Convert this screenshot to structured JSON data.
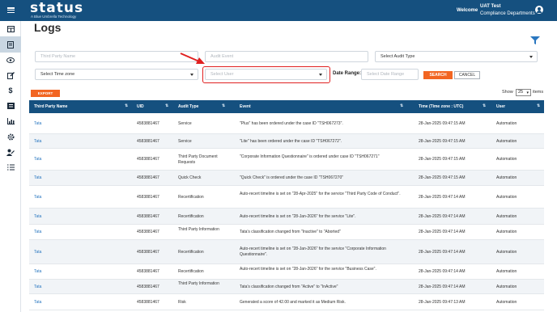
{
  "app": {
    "logo": "status",
    "logo_tagline": "A Blue Umbrella Technology"
  },
  "header": {
    "welcome": "Welcome",
    "user_name": "UAT Test",
    "user_dept": "Compliance Departments"
  },
  "page": {
    "title": "Logs"
  },
  "sidebar": {
    "items": [
      "table-icon",
      "document-icon",
      "eye-icon",
      "edit-icon",
      "dollar-icon",
      "list-icon",
      "chart-icon",
      "gear-icon",
      "user-edit-icon",
      "checklist-icon"
    ]
  },
  "filters": {
    "third_party_placeholder": "Third Party Name",
    "audit_event_placeholder": "Audit Event",
    "audit_type_value": "Select Audit Type",
    "time_zone_value": "Select Time zone",
    "user_placeholder": "Select User",
    "date_range_label": "Date Range:",
    "date_range_placeholder": "Select Date Range",
    "search_label": "SEARCH",
    "cancel_label": "CANCEL"
  },
  "toolbar": {
    "export_label": "EXPORT",
    "show_label": "Show",
    "show_value": "25",
    "items_label": "items"
  },
  "table": {
    "columns": [
      "Third Party Name",
      "UID",
      "Audit Type",
      "Event",
      "Time (Time zone : UTC)",
      "User"
    ],
    "rows": [
      [
        "Tata",
        "4583881467",
        "Service",
        "\"Plus\" has been ordered under the case ID \"TSH067273\".",
        "28-Jan-2025 09:47:15 AM",
        "Automation"
      ],
      [
        "Tata",
        "4583881467",
        "Service",
        "\"Lite\" has been ordered under the case ID \"TSH067272\".",
        "28-Jan-2025 09:47:15 AM",
        "Automation"
      ],
      [
        "Tata",
        "4583881467",
        "Third Party Document Requests",
        "\"Corporate Information Questionnaire\" is ordered under case ID \"TSH067271\"",
        "28-Jan-2025 09:47:15 AM",
        "Automation"
      ],
      [
        "Tata",
        "4583881467",
        "Quick Check",
        "\"Quick Check\" is ordered under the case ID \"TSH067270\"",
        "28-Jan-2025 09:47:15 AM",
        "Automation"
      ],
      [
        "Tata",
        "4583881467",
        "Recertification",
        "Auto-recert timeline is set on \"28-Apr-2025\" for the service \"Third Party Code of Conduct\".",
        "28-Jan-2025 09:47:14 AM",
        "Automation"
      ],
      [
        "Tata",
        "4583881467",
        "Recertification",
        "Auto-recert timeline is set on \"28-Jan-2026\" for the service \"Lite\".",
        "28-Jan-2025 09:47:14 AM",
        "Automation"
      ],
      [
        "Tata",
        "4583881467",
        "Third Party Information",
        "Tata's classification changed from \"Inactive\" to \"Aborted\"",
        "28-Jan-2025 09:47:14 AM",
        "Automation"
      ],
      [
        "Tata",
        "4583881467",
        "Recertification",
        "Auto-recert timeline is set on \"28-Jan-2026\" for the service \"Corporate Information Questionnaire\".",
        "28-Jan-2025 09:47:14 AM",
        "Automation"
      ],
      [
        "Tata",
        "4583881467",
        "Recertification",
        "Auto-recert timeline is set on \"28-Jan-2026\" for the service \"Business Case\".",
        "28-Jan-2025 09:47:14 AM",
        "Automation"
      ],
      [
        "Tata",
        "4583881467",
        "Third Party Information",
        "Tata's classification changed from \"Active\" to \"InActive\"",
        "28-Jan-2025 09:47:14 AM",
        "Automation"
      ],
      [
        "Tata",
        "4583881467",
        "Risk",
        "Generated a score of 42.00 and marked it as Medium Risk.",
        "28-Jan-2025 09:47:13 AM",
        "Automation"
      ]
    ]
  },
  "colors": {
    "primary": "#15507f",
    "accent": "#f26522",
    "link": "#2a77c0",
    "highlight": "#e02020"
  }
}
